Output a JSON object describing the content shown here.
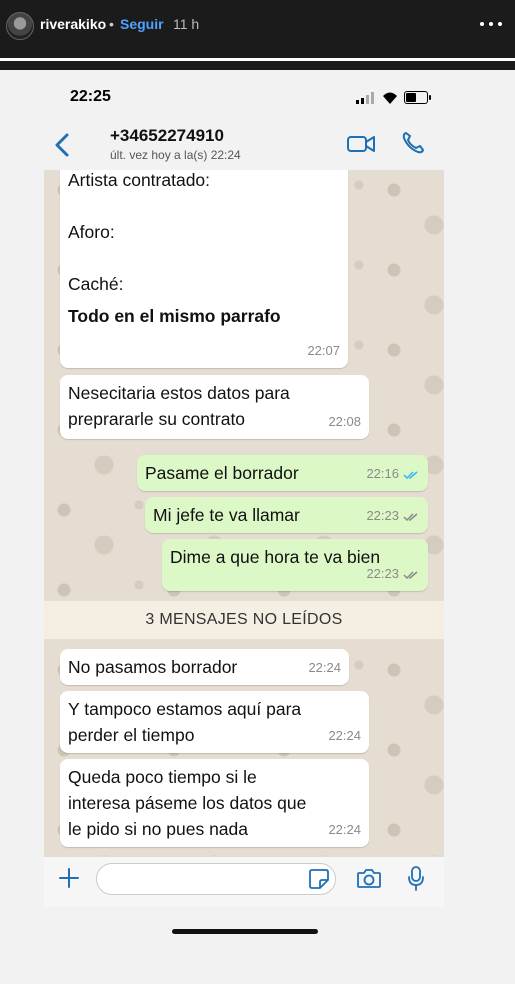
{
  "story": {
    "username": "riverakiko",
    "dot": "•",
    "follow_label": "Seguir",
    "time_ago": "11 h"
  },
  "status_bar": {
    "time": "22:25"
  },
  "chat_header": {
    "contact": "+34652274910",
    "last_seen": "últ. vez hoy a la(s) 22:24"
  },
  "messages": [
    {
      "text": "Artista contratado:\n\nAforo:\n\nCaché:",
      "bold_text": "Todo en el mismo parrafo",
      "time": "22:07",
      "direction": "in"
    },
    {
      "text": "Nesecitaria estos datos para\npreprararle su contrato",
      "time": "22:08",
      "direction": "in"
    },
    {
      "text": "Pasame el borrador",
      "time": "22:16",
      "direction": "out",
      "status": "read"
    },
    {
      "text": "Mi jefe te va llamar",
      "time": "22:23",
      "direction": "out",
      "status": "delivered"
    },
    {
      "text": "Dime a que hora te va bien",
      "time": "22:23",
      "direction": "out",
      "status": "delivered"
    },
    {
      "text": "No pasamos borrador",
      "time": "22:24",
      "direction": "in"
    },
    {
      "text": "Y tampoco estamos aquí para\nperder el tiempo",
      "time": "22:24",
      "direction": "in"
    },
    {
      "text": "Queda poco tiempo si le\ninteresa páseme los datos que\nle pido si no pues nada",
      "time": "22:24",
      "direction": "in"
    }
  ],
  "unread_banner": "3 MENSAJES NO LEÍDOS",
  "input": {
    "placeholder": "",
    "value": ""
  },
  "colors": {
    "incoming_bubble": "#ffffff",
    "outgoing_bubble": "#dcf8c6",
    "read_ticks": "#34b7f1",
    "delivered_ticks": "#8a8a8a",
    "accent": "#1f6fb5",
    "follow_link": "#4ea3ff"
  },
  "icons": {
    "back": "chevron-left-icon",
    "video": "video-call-icon",
    "call": "phone-icon",
    "attach": "plus-icon",
    "sticker": "sticker-icon",
    "camera": "camera-icon",
    "mic": "microphone-icon",
    "more": "more-horizontal-icon"
  }
}
